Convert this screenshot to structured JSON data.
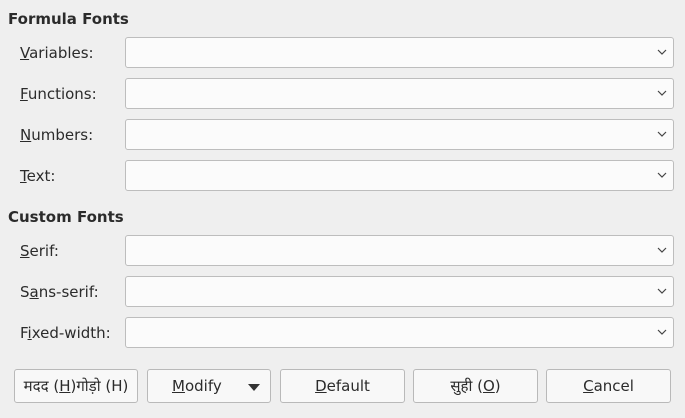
{
  "formula_fonts": {
    "title": "Formula Fonts",
    "rows": [
      {
        "pre": "",
        "u": "V",
        "post": "ariables:"
      },
      {
        "pre": "",
        "u": "F",
        "post": "unctions:"
      },
      {
        "pre": "",
        "u": "N",
        "post": "umbers:"
      },
      {
        "pre": "",
        "u": "T",
        "post": "ext:"
      }
    ]
  },
  "custom_fonts": {
    "title": "Custom Fonts",
    "rows": [
      {
        "pre": "",
        "u": "S",
        "post": "erif:"
      },
      {
        "pre": "S",
        "u": "a",
        "post": "ns-serif:"
      },
      {
        "pre": "F",
        "u": "i",
        "post": "xed-width:"
      }
    ]
  },
  "buttons": {
    "help": {
      "pre": "मदद (",
      "u": "H",
      "post": ")गोड़ो (H)"
    },
    "modify": {
      "pre": "",
      "u": "M",
      "post": "odify"
    },
    "default": {
      "pre": "",
      "u": "D",
      "post": "efault"
    },
    "ok": {
      "pre": "सुही (",
      "u": "O",
      "post": ")"
    },
    "cancel": {
      "pre": "",
      "u": "C",
      "post": "ancel"
    }
  },
  "icons": {
    "select_chevron": "chevron-down-icon",
    "modify_dropdown": "triangle-down-icon"
  }
}
